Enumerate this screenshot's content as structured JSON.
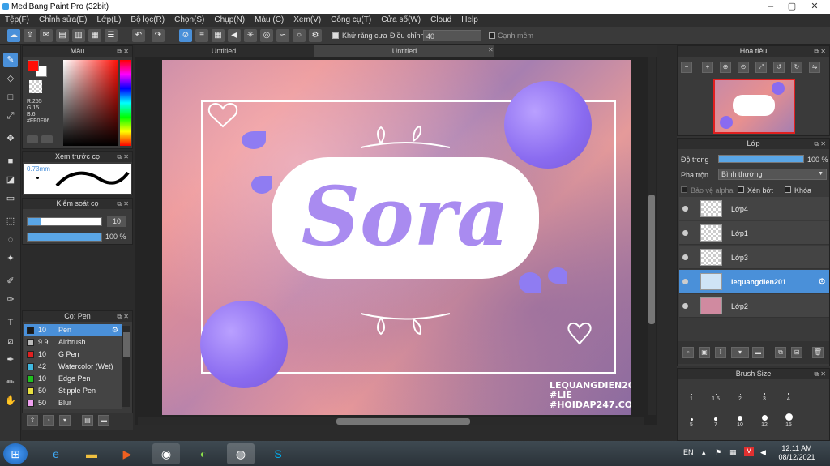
{
  "window": {
    "title": "MediBang Paint Pro (32bit)"
  },
  "menu": [
    "Tệp(F)",
    "Chỉnh sửa(E)",
    "Lớp(L)",
    "Bộ lọc(R)",
    "Chọn(S)",
    "Chụp(N)",
    "Màu (C)",
    "Xem(V)",
    "Công cụ(T)",
    "Cửa sổ(W)",
    "Cloud",
    "Help"
  ],
  "toolbar": {
    "antialias_label": "Khử răng cưa",
    "adjust_label": "Điều chỉnh",
    "adjust_value": "40",
    "edge_label": "Cạnh mềm"
  },
  "color_panel": {
    "title": "Màu",
    "r": "R:255",
    "g": "G:15",
    "b": "B:6",
    "hex": "#FF0F06",
    "fg": "#ff0f06"
  },
  "preview_panel": {
    "title": "Xem trước cọ",
    "size": "0.73mm"
  },
  "brush_control": {
    "title": "Kiểm soát cọ",
    "size": "10",
    "opacity": "100 %"
  },
  "brush_list": {
    "title": "Cọ: Pen",
    "items": [
      {
        "size": "10",
        "name": "Pen",
        "color": "#1a1a1a"
      },
      {
        "size": "9.9",
        "name": "Airbrush",
        "color": "#bbbbbb"
      },
      {
        "size": "10",
        "name": "G Pen",
        "color": "#e02020"
      },
      {
        "size": "42",
        "name": "Watercolor (Wet)",
        "color": "#40b8e0"
      },
      {
        "size": "10",
        "name": "Edge Pen",
        "color": "#20c020"
      },
      {
        "size": "50",
        "name": "Stipple Pen",
        "color": "#e8e040"
      },
      {
        "size": "50",
        "name": "Blur",
        "color": "#f0a0f0"
      }
    ]
  },
  "tabs": [
    "Untitled",
    "Untitled"
  ],
  "canvas": {
    "art_text": "Sora",
    "credit1": "LEQUANGDIEN201",
    "credit2": "#LIE",
    "credit3": "#HOIDAP247.COM"
  },
  "navigator": {
    "title": "Hoa tiêu"
  },
  "layer_panel": {
    "title": "Lớp",
    "opacity_label": "Độ trong",
    "opacity_value": "100 %",
    "blend_label": "Pha trộn",
    "blend_value": "Bình thường",
    "protect_alpha": "Bảo vệ alpha",
    "clip": "Xén bớt",
    "lock": "Khóa",
    "layers": [
      "Lớp4",
      "Lớp1",
      "Lớp3",
      "lequangdien201",
      "Lớp2"
    ]
  },
  "brush_size": {
    "title": "Brush Size",
    "row1": [
      "1",
      "1.5",
      "2",
      "3",
      "4"
    ],
    "row2": [
      "5",
      "7",
      "10",
      "12",
      "15"
    ]
  },
  "taskbar": {
    "lang": "EN",
    "time": "12:11 AM",
    "date": "08/12/2021"
  }
}
